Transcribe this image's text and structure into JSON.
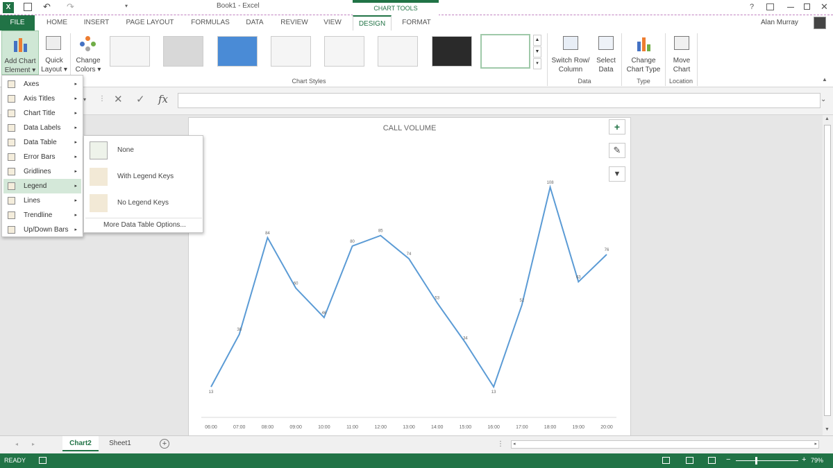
{
  "window": {
    "title": "Book1 - Excel",
    "user": "Alan Murray",
    "help": "?",
    "context_tab": "CHART TOOLS"
  },
  "tabs": [
    "FILE",
    "HOME",
    "INSERT",
    "PAGE LAYOUT",
    "FORMULAS",
    "DATA",
    "REVIEW",
    "VIEW",
    "DESIGN",
    "FORMAT"
  ],
  "ribbon": {
    "add_chart_element": [
      "Add Chart",
      "Element ▾"
    ],
    "quick_layout": [
      "Quick",
      "Layout ▾"
    ],
    "change_colors": [
      "Change",
      "Colors ▾"
    ],
    "chart_styles_label": "Chart Styles",
    "switch_row_col": [
      "Switch Row/",
      "Column"
    ],
    "select_data": [
      "Select",
      "Data"
    ],
    "data_label": "Data",
    "change_chart_type": [
      "Change",
      "Chart Type"
    ],
    "type_label": "Type",
    "move_chart": [
      "Move",
      "Chart"
    ],
    "location_label": "Location"
  },
  "formula": {
    "fx": "fx",
    "cancel": "✕",
    "enter": "✓"
  },
  "menu": {
    "items": [
      "Axes",
      "Axis Titles",
      "Chart Title",
      "Data Labels",
      "Data Table",
      "Error Bars",
      "Gridlines",
      "Legend",
      "Lines",
      "Trendline",
      "Up/Down Bars"
    ]
  },
  "submenu": {
    "items": [
      "None",
      "With Legend Keys",
      "No Legend Keys"
    ],
    "more": "More Data Table Options..."
  },
  "chart_side": {
    "add": "+",
    "brush": "✎",
    "filter": "▼"
  },
  "sheet_tabs": [
    "Chart2",
    "Sheet1"
  ],
  "status": {
    "ready": "READY",
    "zoom": "79%"
  },
  "chart_data": {
    "type": "line",
    "title": "CALL VOLUME",
    "categories": [
      "06:00",
      "07:00",
      "08:00",
      "09:00",
      "10:00",
      "11:00",
      "12:00",
      "13:00",
      "14:00",
      "15:00",
      "16:00",
      "17:00",
      "18:00",
      "19:00",
      "20:00"
    ],
    "series": [
      {
        "values": [
          13,
          38,
          84,
          60,
          46,
          80,
          85,
          74,
          53,
          34,
          13,
          52,
          108,
          63,
          76
        ]
      }
    ],
    "color": "#5b9bd5"
  }
}
